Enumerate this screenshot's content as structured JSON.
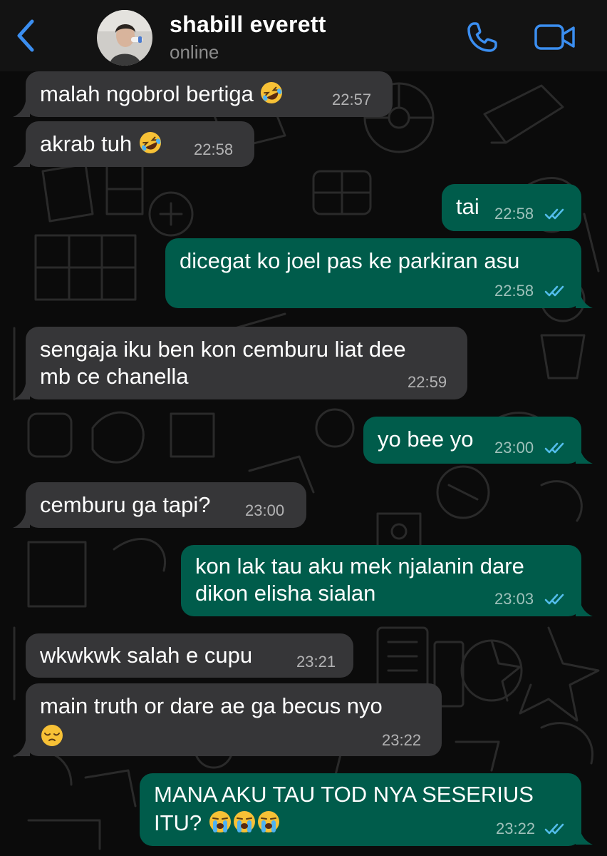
{
  "header": {
    "contact_name": "shabill everett",
    "contact_status": "online"
  },
  "colors": {
    "header_bg": "#131313",
    "background": "#0b0b0b",
    "incoming_bubble": "#363638",
    "outgoing_bubble": "#005c4b",
    "accent_blue": "#3b8ef0",
    "read_ticks": "#53bdeb"
  },
  "icons": {
    "back": "chevron-left-icon",
    "call": "phone-icon",
    "video": "video-camera-icon",
    "read_receipt": "double-check-icon"
  },
  "messages": [
    {
      "direction": "in",
      "lines": [
        "malah ngobrol bertiga"
      ],
      "emoji": [
        "rofl"
      ],
      "time": "22:57"
    },
    {
      "direction": "in",
      "lines": [
        "akrab tuh"
      ],
      "emoji": [
        "rofl"
      ],
      "time": "22:58"
    },
    {
      "direction": "out",
      "lines": [
        "tai"
      ],
      "time": "22:58",
      "read": true
    },
    {
      "direction": "out",
      "lines": [
        "dicegat ko joel pas ke parkiran asu"
      ],
      "time": "22:58",
      "read": true
    },
    {
      "direction": "in",
      "lines": [
        "sengaja iku ben kon cemburu liat dee",
        "mb ce chanella"
      ],
      "time": "22:59"
    },
    {
      "direction": "out",
      "lines": [
        "yo bee yo"
      ],
      "time": "23:00",
      "read": true
    },
    {
      "direction": "in",
      "lines": [
        "cemburu ga tapi?"
      ],
      "time": "23:00"
    },
    {
      "direction": "out",
      "lines": [
        "kon lak tau aku mek njalanin dare",
        "dikon elisha sialan"
      ],
      "time": "23:03",
      "read": true
    },
    {
      "direction": "in",
      "lines": [
        "wkwkwk salah e cupu"
      ],
      "time": "23:21"
    },
    {
      "direction": "in",
      "lines": [
        "main truth or dare ae ga becus nyo"
      ],
      "emoji": [
        "pensive"
      ],
      "time": "23:22"
    },
    {
      "direction": "out",
      "lines": [
        "MANA AKU TAU TOD NYA SESERIUS",
        "ITU?"
      ],
      "emoji": [
        "sob",
        "sob",
        "sob"
      ],
      "time": "23:22",
      "read": true
    }
  ]
}
